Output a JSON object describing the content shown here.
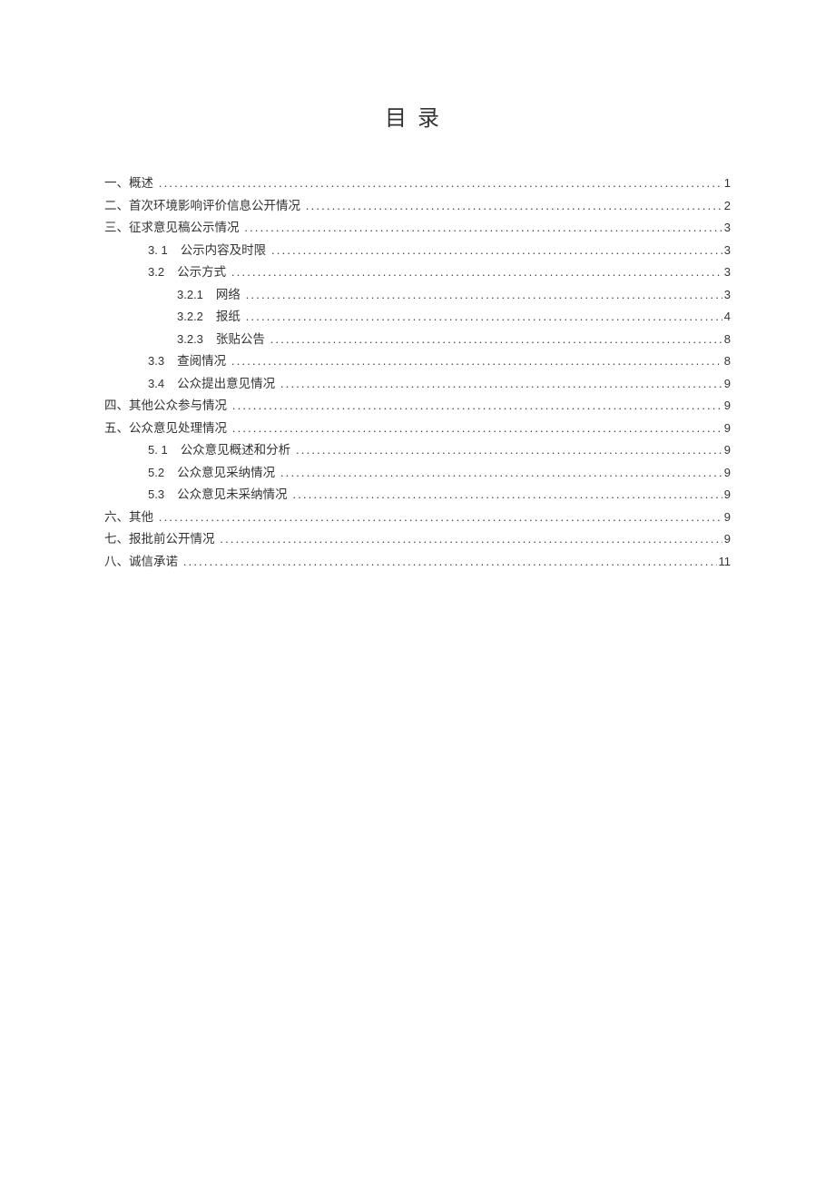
{
  "title": "目录",
  "entries": [
    {
      "level": 0,
      "num": "",
      "text": "一、概述",
      "page": "1"
    },
    {
      "level": 0,
      "num": "",
      "text": "二、首次环境影响评价信息公开情况",
      "page": "2"
    },
    {
      "level": 0,
      "num": "",
      "text": "三、征求意见稿公示情况",
      "page": "3"
    },
    {
      "level": 1,
      "num": "3.  1",
      "text": "公示内容及时限",
      "page": "3",
      "numSpaced": false
    },
    {
      "level": 1,
      "num": "3.2",
      "text": "公示方式",
      "page": "3"
    },
    {
      "level": 2,
      "num": "3.2.1",
      "text": "网络",
      "page": "3"
    },
    {
      "level": 2,
      "num": "3.2.2",
      "text": "报纸",
      "page": "4"
    },
    {
      "level": 2,
      "num": "3.2.3",
      "text": "张贴公告",
      "page": "8"
    },
    {
      "level": 1,
      "num": "3.3",
      "text": "查阅情况",
      "page": "8"
    },
    {
      "level": 1,
      "num": "3.4",
      "text": "公众提出意见情况",
      "page": "9"
    },
    {
      "level": 0,
      "num": "",
      "text": "四、其他公众参与情况",
      "page": "9"
    },
    {
      "level": 0,
      "num": "",
      "text": "五、公众意见处理情况",
      "page": "9"
    },
    {
      "level": 1,
      "num": "5.  1",
      "text": "公众意见概述和分析",
      "page": "9",
      "numSpaced": false
    },
    {
      "level": 1,
      "num": "5.2",
      "text": "公众意见采纳情况",
      "page": "9"
    },
    {
      "level": 1,
      "num": "5.3",
      "text": "公众意见未采纳情况",
      "page": "9"
    },
    {
      "level": 0,
      "num": "",
      "text": "六、其他",
      "page": "9"
    },
    {
      "level": 0,
      "num": "",
      "text": "七、报批前公开情况",
      "page": "9"
    },
    {
      "level": 0,
      "num": "",
      "text": "八、诚信承诺",
      "page": "11"
    }
  ]
}
